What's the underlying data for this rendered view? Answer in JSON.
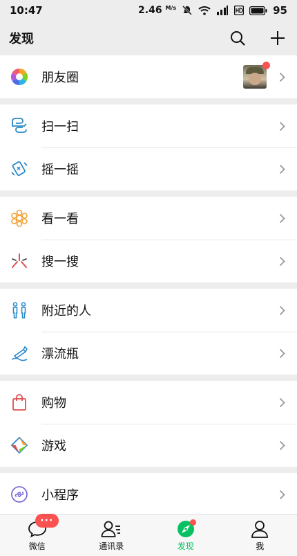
{
  "status_bar": {
    "time": "10:47",
    "speed": "2.46",
    "speed_unit": "M/s",
    "battery": "95"
  },
  "header": {
    "title": "发现"
  },
  "groups": [
    [
      {
        "label": "朋友圈",
        "icon": "moments-icon"
      }
    ],
    [
      {
        "label": "扫一扫",
        "icon": "scan-icon"
      },
      {
        "label": "摇一摇",
        "icon": "shake-icon"
      }
    ],
    [
      {
        "label": "看一看",
        "icon": "top-stories-icon"
      },
      {
        "label": "搜一搜",
        "icon": "search-icon"
      }
    ],
    [
      {
        "label": "附近的人",
        "icon": "people-nearby-icon"
      },
      {
        "label": "漂流瓶",
        "icon": "drift-bottle-icon"
      }
    ],
    [
      {
        "label": "购物",
        "icon": "shopping-bag-icon"
      },
      {
        "label": "游戏",
        "icon": "games-icon"
      }
    ],
    [
      {
        "label": "小程序",
        "icon": "mini-programs-icon"
      }
    ]
  ],
  "tabbar": {
    "tabs": [
      {
        "label": "微信",
        "icon": "chats-icon",
        "badge": "···"
      },
      {
        "label": "通讯录",
        "icon": "contacts-icon"
      },
      {
        "label": "发现",
        "icon": "discover-icon",
        "active": true
      },
      {
        "label": "我",
        "icon": "me-icon"
      }
    ]
  },
  "colors": {
    "accent": "#07c160",
    "badge": "#fa5151",
    "background": "#ededed"
  }
}
